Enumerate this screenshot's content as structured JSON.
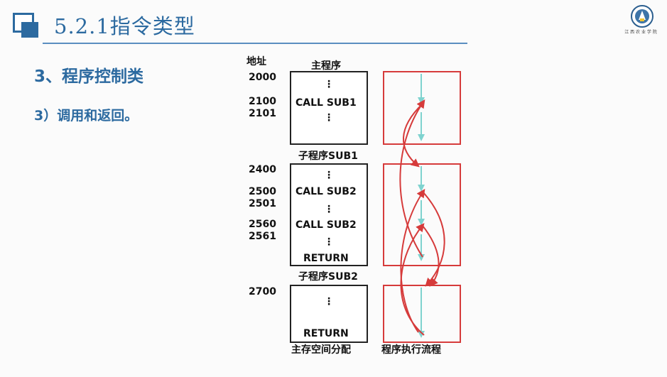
{
  "header": {
    "title": "5.2.1指令类型",
    "logo_text": "江 西 农 业 学 院"
  },
  "content": {
    "section_title": "3、程序控制类",
    "sub_title": "3）调用和返回。"
  },
  "diagram": {
    "addr_header": "地址",
    "main_label": "主程序",
    "sub1_label": "子程序SUB1",
    "sub2_label": "子程序SUB2",
    "mem_caption": "主存空间分配",
    "flow_caption": "程序执行流程",
    "addresses": {
      "a2000": "2000",
      "a2100": "2100",
      "a2101": "2101",
      "a2400": "2400",
      "a2500": "2500",
      "a2501": "2501",
      "a2560": "2560",
      "a2561": "2561",
      "a2700": "2700"
    },
    "instructions": {
      "call_sub1": "CALL SUB1",
      "call_sub2_a": "CALL SUB2",
      "call_sub2_b": "CALL SUB2",
      "return_sub1": "RETURN",
      "return_sub2": "RETURN"
    },
    "dots": "⋮",
    "colors": {
      "call_arrow": "#d63b3b",
      "seq_arrow": "#7fd3cf",
      "block_border": "#222222",
      "accent": "#2c6aa0"
    }
  }
}
